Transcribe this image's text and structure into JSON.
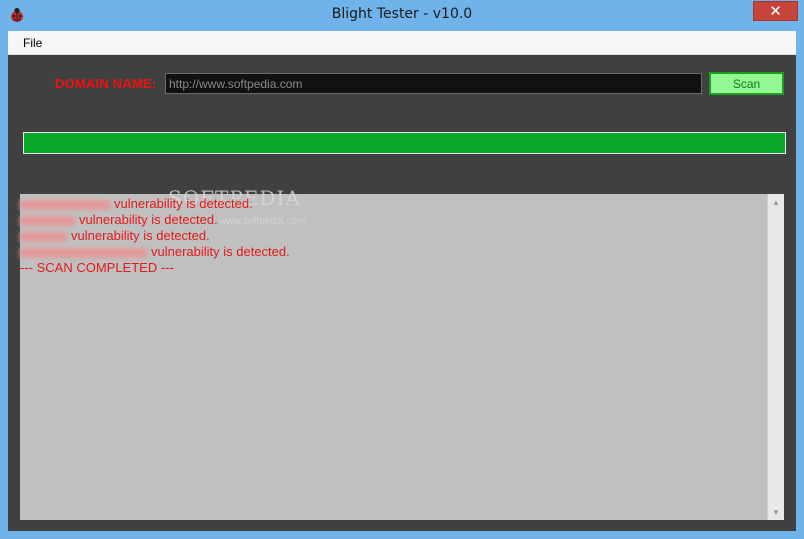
{
  "window": {
    "title": "Blight Tester - v10.0",
    "close_glyph": "✕",
    "app_icon": "ladybug-icon"
  },
  "menu": {
    "items": [
      {
        "label": "File"
      }
    ]
  },
  "domain": {
    "label": "DOMAIN NAME:",
    "value": "http://www.softpedia.com",
    "scan_label": "Scan"
  },
  "progress": {
    "percent": 100,
    "color": "#0aa82a"
  },
  "output": {
    "watermark": "SOFTPEDIA",
    "watermark_sub": "www.softpedia.com",
    "lines": [
      {
        "text": "vulnerability is detected."
      },
      {
        "text": "vulnerability is detected."
      },
      {
        "text": "vulnerability is detected."
      },
      {
        "text": "vulnerability is detected."
      },
      {
        "text": "--- SCAN COMPLETED ---"
      }
    ]
  },
  "colors": {
    "accent_red": "#ee1111",
    "output_text": "#e21a1a",
    "scan_green": "#1e9e1e",
    "background": "#404040"
  }
}
